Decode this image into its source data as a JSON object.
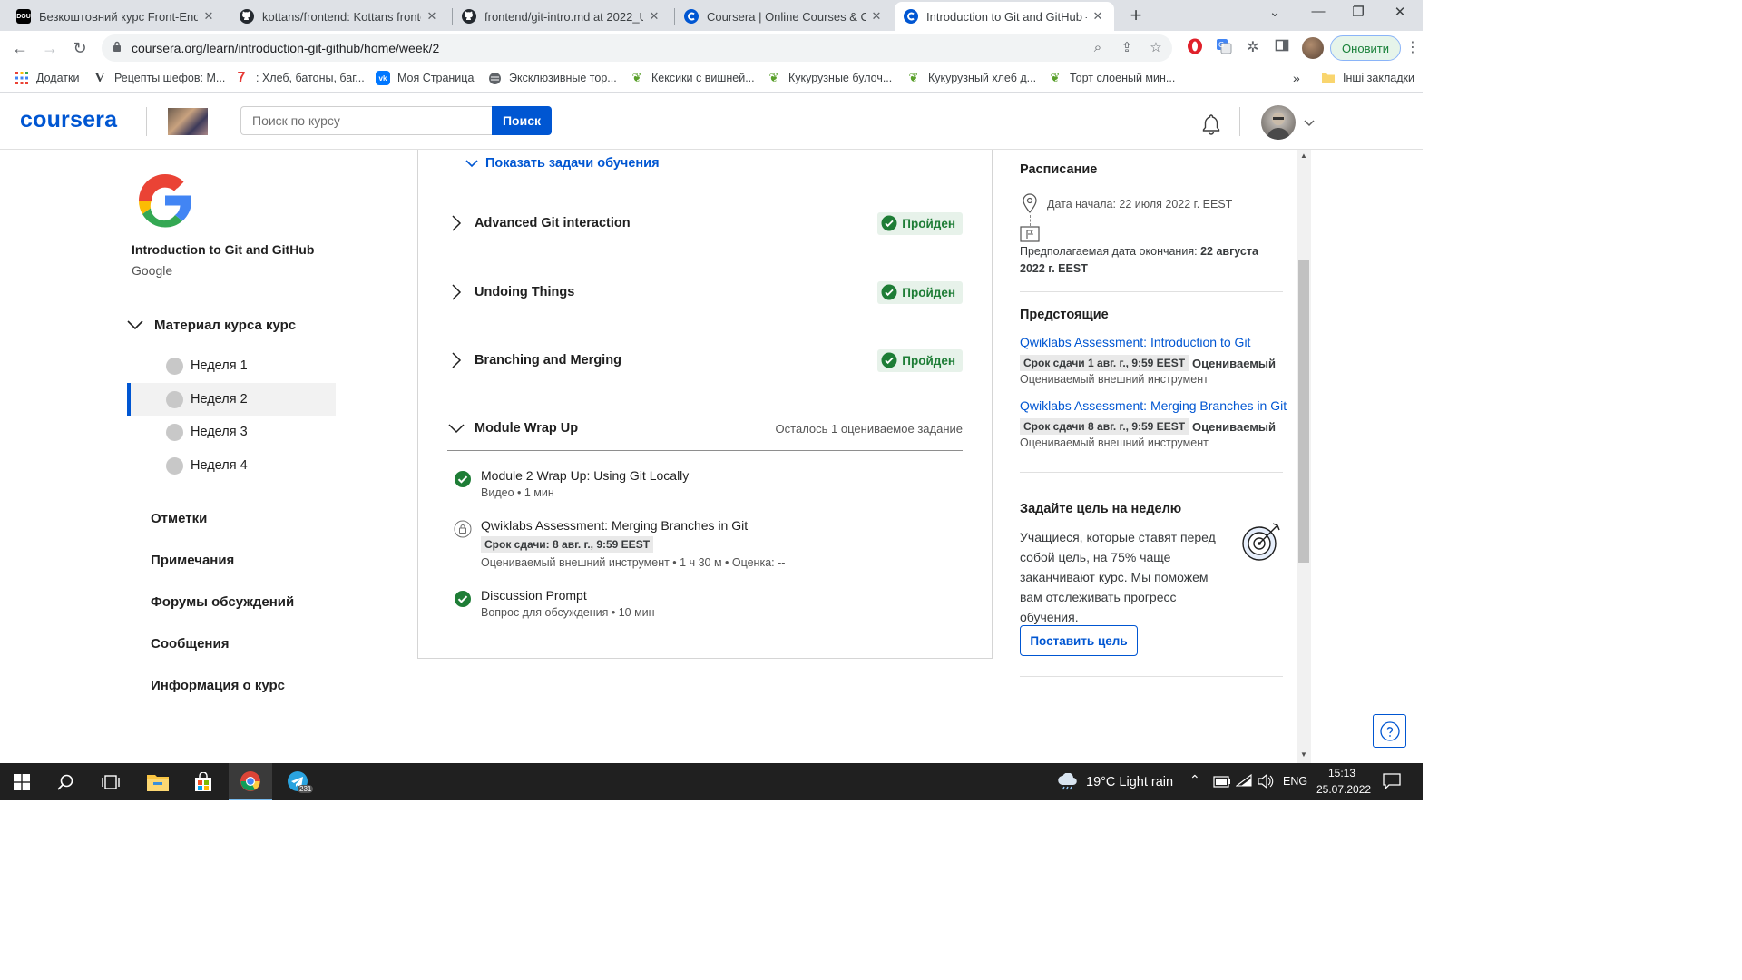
{
  "browser": {
    "tabs": [
      {
        "title": "Безкоштовний курс Front-End в",
        "favicon": "dou-icon"
      },
      {
        "title": "kottans/frontend: Kottans fronter",
        "favicon": "github-icon"
      },
      {
        "title": "frontend/git-intro.md at 2022_U",
        "favicon": "github-icon"
      },
      {
        "title": "Coursera | Online Courses & Cred",
        "favicon": "coursera-icon"
      },
      {
        "title": "Introduction to Git and GitHub –",
        "favicon": "coursera-icon"
      }
    ],
    "url": "coursera.org/learn/introduction-git-github/home/week/2",
    "update_label": "Оновити",
    "bookmarks": [
      {
        "label": "Додатки"
      },
      {
        "label": "Рецепты шефов: М..."
      },
      {
        "label": ": Хлеб, батоны, баг..."
      },
      {
        "label": "Моя Страница"
      },
      {
        "label": "Эксклюзивные тор..."
      },
      {
        "label": "Кексики с вишней..."
      },
      {
        "label": "Кукурузные булоч..."
      },
      {
        "label": "Кукурузный хлеб д..."
      },
      {
        "label": "Торт слоеный мин..."
      }
    ],
    "bookmarks_more": "»",
    "other_bookmarks": "Інші закладки"
  },
  "header": {
    "logo": "coursera",
    "search_placeholder": "Поиск по курсу",
    "search_button": "Поиск",
    "brand_color": "#0056d2"
  },
  "sidebar": {
    "course_title": "Introduction to Git and GitHub",
    "course_org": "Google",
    "material_header": "Материал курса курс",
    "weeks": [
      {
        "label": "Неделя 1"
      },
      {
        "label": "Неделя 2"
      },
      {
        "label": "Неделя 3"
      },
      {
        "label": "Неделя 4"
      }
    ],
    "selected_week": "Неделя 2",
    "links": [
      {
        "label": "Отметки"
      },
      {
        "label": "Примечания"
      },
      {
        "label": "Форумы обсуждений"
      },
      {
        "label": "Сообщения"
      },
      {
        "label": "Информация о курс"
      }
    ]
  },
  "main": {
    "show_tasks_label": "Показать задачи обучения",
    "modules": [
      {
        "name": "Advanced Git interaction",
        "status": "Пройден"
      },
      {
        "name": "Undoing Things",
        "status": "Пройден"
      },
      {
        "name": "Branching and Merging",
        "status": "Пройден"
      }
    ],
    "wrap_up": {
      "name": "Module Wrap Up",
      "remaining": "Осталось 1 оцениваемое задание",
      "items": [
        {
          "title": "Module 2 Wrap Up: Using Git Locally",
          "meta": "Видео • 1 мин",
          "status": "completed"
        },
        {
          "title": "Qwiklabs Assessment: Merging Branches in Git",
          "due": "Срок сдачи: 8 авг. г., 9:59 EEST",
          "meta": "Оцениваемый внешний инструмент • 1 ч 30 м • Оценка: --",
          "status": "locked"
        },
        {
          "title": "Discussion Prompt",
          "meta": "Вопрос для обсуждения • 10 мин",
          "status": "completed"
        }
      ]
    },
    "passed_color": "#1e7d36"
  },
  "right": {
    "schedule_title": "Расписание",
    "start_date": "Дата начала: 22 июля 2022 г. EEST",
    "end_label": "Предполагаемая дата окончания:",
    "end_value_1": "22 августа",
    "end_value_2": "2022 г. EEST",
    "upcoming_title": "Предстоящие",
    "upcoming": [
      {
        "link": "Qwiklabs Assessment: Introduction to Git",
        "due": "Срок сдачи 1 авг. г., 9:59 EEST",
        "graded": "Оцениваемый",
        "type": "Оцениваемый внешний инструмент"
      },
      {
        "link": "Qwiklabs Assessment: Merging Branches in Git",
        "due": "Срок сдачи 8 авг. г., 9:59 EEST",
        "graded": "Оцениваемый",
        "type": "Оцениваемый внешний инструмент"
      }
    ],
    "goal_title": "Задайте цель на неделю",
    "goal_desc": "Учащиеся, которые ставят перед собой цель, на 75% чаще заканчивают курс. Мы поможем вам отслеживать прогресс обучения.",
    "goal_button": "Поставить цель"
  },
  "taskbar": {
    "weather": "19°C  Light rain",
    "lang": "ENG",
    "time": "15:13",
    "date": "25.07.2022",
    "telegram_badge": "231"
  }
}
